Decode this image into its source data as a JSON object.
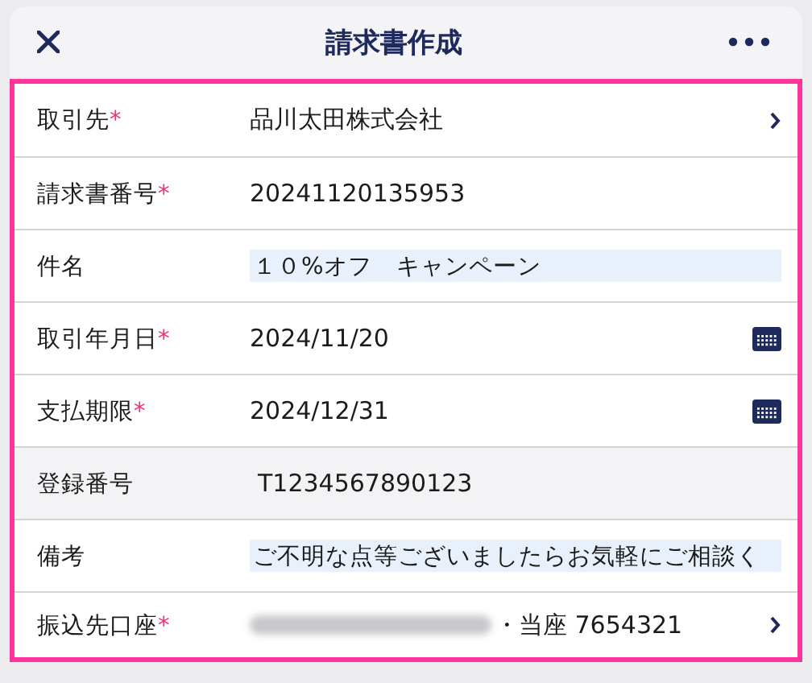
{
  "header": {
    "title": "請求書作成"
  },
  "rows": [
    {
      "label": "取引先",
      "mark": "*",
      "kind": "select",
      "value": "品川太田株式会社",
      "disabled": false,
      "redacted": false
    },
    {
      "label": "請求書番号",
      "mark": "*",
      "kind": "text",
      "value": "20241120135953",
      "disabled": false,
      "redacted": false
    },
    {
      "label": "件名",
      "kind": "input",
      "value": "１０%オフ　キャンペーン",
      "disabled": false,
      "redacted": false
    },
    {
      "label": "取引年月日",
      "mark": "*",
      "kind": "date",
      "value": "2024/11/20",
      "disabled": false,
      "redacted": false
    },
    {
      "label": "支払期限",
      "mark": "*",
      "kind": "date",
      "value": "2024/12/31",
      "disabled": false,
      "redacted": false
    },
    {
      "label": "登録番号",
      "kind": "text",
      "value": "T1234567890123",
      "disabled": true,
      "redacted": false
    },
    {
      "label": "備考",
      "kind": "input",
      "value": "ご不明な点等ございましたらお気軽にご相談く",
      "disabled": false,
      "redacted": false
    },
    {
      "label": "振込先口座",
      "mark": "*",
      "kind": "select",
      "value": "・当座 7654321",
      "disabled": false,
      "redacted": true
    }
  ]
}
